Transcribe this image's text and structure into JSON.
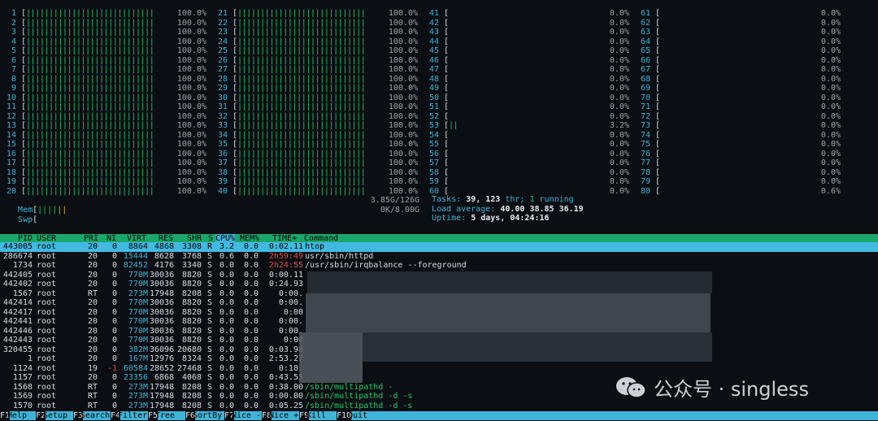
{
  "window": {
    "title": "htop"
  },
  "cpus": {
    "col1": [
      {
        "id": "1",
        "pct": "100.0%"
      },
      {
        "id": "2",
        "pct": "100.0%"
      },
      {
        "id": "3",
        "pct": "100.0%"
      },
      {
        "id": "4",
        "pct": "100.0%"
      },
      {
        "id": "5",
        "pct": "100.0%"
      },
      {
        "id": "6",
        "pct": "100.0%"
      },
      {
        "id": "7",
        "pct": "100.0%"
      },
      {
        "id": "8",
        "pct": "100.0%"
      },
      {
        "id": "9",
        "pct": "100.0%"
      },
      {
        "id": "10",
        "pct": "100.0%"
      },
      {
        "id": "11",
        "pct": "100.0%"
      },
      {
        "id": "12",
        "pct": "100.0%"
      },
      {
        "id": "13",
        "pct": "100.0%"
      },
      {
        "id": "14",
        "pct": "100.0%"
      },
      {
        "id": "15",
        "pct": "100.0%"
      },
      {
        "id": "16",
        "pct": "100.0%"
      },
      {
        "id": "17",
        "pct": "100.0%"
      },
      {
        "id": "18",
        "pct": "100.0%"
      },
      {
        "id": "19",
        "pct": "100.0%"
      },
      {
        "id": "20",
        "pct": "100.0%"
      }
    ],
    "col2": [
      {
        "id": "21",
        "pct": "100.0%"
      },
      {
        "id": "22",
        "pct": "100.0%"
      },
      {
        "id": "23",
        "pct": "100.0%"
      },
      {
        "id": "24",
        "pct": "100.0%"
      },
      {
        "id": "25",
        "pct": "100.0%"
      },
      {
        "id": "26",
        "pct": "100.0%"
      },
      {
        "id": "27",
        "pct": "100.0%"
      },
      {
        "id": "28",
        "pct": "100.0%"
      },
      {
        "id": "29",
        "pct": "100.0%"
      },
      {
        "id": "30",
        "pct": "100.0%"
      },
      {
        "id": "31",
        "pct": "100.0%"
      },
      {
        "id": "32",
        "pct": "100.0%"
      },
      {
        "id": "33",
        "pct": "100.0%"
      },
      {
        "id": "34",
        "pct": "100.0%"
      },
      {
        "id": "35",
        "pct": "100.0%"
      },
      {
        "id": "36",
        "pct": "100.0%"
      },
      {
        "id": "37",
        "pct": "100.0%"
      },
      {
        "id": "38",
        "pct": "100.0%"
      },
      {
        "id": "39",
        "pct": "100.0%"
      },
      {
        "id": "40",
        "pct": "100.0%"
      }
    ],
    "col3": [
      {
        "id": "41",
        "pct": "0.0%"
      },
      {
        "id": "42",
        "pct": "0.0%"
      },
      {
        "id": "43",
        "pct": "0.0%"
      },
      {
        "id": "44",
        "pct": "0.0%"
      },
      {
        "id": "45",
        "pct": "0.0%"
      },
      {
        "id": "46",
        "pct": "0.0%"
      },
      {
        "id": "47",
        "pct": "0.0%"
      },
      {
        "id": "48",
        "pct": "0.0%"
      },
      {
        "id": "49",
        "pct": "0.0%"
      },
      {
        "id": "50",
        "pct": "0.0%"
      },
      {
        "id": "51",
        "pct": "0.0%"
      },
      {
        "id": "52",
        "pct": "0.0%"
      },
      {
        "id": "53",
        "pct": "3.2%"
      },
      {
        "id": "54",
        "pct": "0.0%"
      },
      {
        "id": "55",
        "pct": "0.0%"
      },
      {
        "id": "56",
        "pct": "0.0%"
      },
      {
        "id": "57",
        "pct": "0.0%"
      },
      {
        "id": "58",
        "pct": "0.0%"
      },
      {
        "id": "59",
        "pct": "0.0%"
      },
      {
        "id": "60",
        "pct": "0.0%"
      }
    ],
    "col4": [
      {
        "id": "61",
        "pct": "0.0%"
      },
      {
        "id": "62",
        "pct": "0.0%"
      },
      {
        "id": "63",
        "pct": "0.0%"
      },
      {
        "id": "64",
        "pct": "0.0%"
      },
      {
        "id": "65",
        "pct": "0.0%"
      },
      {
        "id": "66",
        "pct": "0.0%"
      },
      {
        "id": "67",
        "pct": "0.0%"
      },
      {
        "id": "68",
        "pct": "0.0%"
      },
      {
        "id": "69",
        "pct": "0.0%"
      },
      {
        "id": "70",
        "pct": "0.0%"
      },
      {
        "id": "71",
        "pct": "0.0%"
      },
      {
        "id": "72",
        "pct": "0.0%"
      },
      {
        "id": "73",
        "pct": "0.0%"
      },
      {
        "id": "74",
        "pct": "0.0%"
      },
      {
        "id": "75",
        "pct": "0.0%"
      },
      {
        "id": "76",
        "pct": "0.0%"
      },
      {
        "id": "77",
        "pct": "0.0%"
      },
      {
        "id": "78",
        "pct": "0.0%"
      },
      {
        "id": "79",
        "pct": "0.0%"
      },
      {
        "id": "80",
        "pct": "0.6%"
      }
    ]
  },
  "meters": {
    "mem": {
      "label": "Mem",
      "value": "3.85G/126G"
    },
    "swp": {
      "label": "Swp",
      "value": "0K/8.00G"
    }
  },
  "summary": {
    "tasks_label": "Tasks:",
    "tasks": "39,",
    "thr": "123",
    "thr_label": "thr;",
    "running": "1",
    "running_label": "running",
    "load_label": "Load average:",
    "load1": "40.00",
    "load5": "38.85",
    "load15": "36.19",
    "uptime_label": "Uptime:",
    "uptime": "5 days, 04:24:16"
  },
  "columns": [
    "PID",
    "USER",
    "PRI",
    "NI",
    "VIRT",
    "RES",
    "SHR",
    "S",
    "CPU%",
    "MEM%",
    "TIME+",
    "Command"
  ],
  "processes": [
    {
      "pid": "443005",
      "user": "root",
      "pri": "20",
      "ni": "0",
      "virt": "8864",
      "res": "4868",
      "shr": "3308",
      "s": "R",
      "cpu": "3.2",
      "mem": "0.0",
      "time": "0:02.11",
      "cmd": "htop"
    },
    {
      "pid": "286674",
      "user": "root",
      "pri": "20",
      "ni": "0",
      "virt": "15444",
      "res": "8628",
      "shr": "3768",
      "s": "S",
      "cpu": "0.6",
      "mem": "0.0",
      "time": "2h59:49",
      "cmd": "usr/sbin/httpd"
    },
    {
      "pid": "1734",
      "user": "root",
      "pri": "20",
      "ni": "0",
      "virt": "82452",
      "res": "4176",
      "shr": "3340",
      "s": "S",
      "cpu": "0.0",
      "mem": "0.0",
      "time": "2h24:55",
      "cmd": "/usr/sbin/irqbalance --foreground"
    },
    {
      "pid": "442405",
      "user": "root",
      "pri": "20",
      "ni": "0",
      "virt": "770M",
      "res": "30036",
      "shr": "8820",
      "s": "S",
      "cpu": "0.0",
      "mem": "0.0",
      "time": "0:00.11",
      "cmd": ""
    },
    {
      "pid": "442402",
      "user": "root",
      "pri": "20",
      "ni": "0",
      "virt": "770M",
      "res": "30036",
      "shr": "8820",
      "s": "S",
      "cpu": "0.0",
      "mem": "0.0",
      "time": "0:24.93",
      "cmd": ""
    },
    {
      "pid": "1567",
      "user": "root",
      "pri": "RT",
      "ni": "0",
      "virt": "273M",
      "res": "17948",
      "shr": "8208",
      "s": "S",
      "cpu": "0.0",
      "mem": "0.0",
      "time": "0:00.",
      "cmd": ""
    },
    {
      "pid": "442414",
      "user": "root",
      "pri": "20",
      "ni": "0",
      "virt": "770M",
      "res": "30036",
      "shr": "8820",
      "s": "S",
      "cpu": "0.0",
      "mem": "0.0",
      "time": "0:00.",
      "cmd": ""
    },
    {
      "pid": "442417",
      "user": "root",
      "pri": "20",
      "ni": "0",
      "virt": "770M",
      "res": "30036",
      "shr": "8820",
      "s": "S",
      "cpu": "0.0",
      "mem": "0.0",
      "time": "0:00",
      "cmd": ""
    },
    {
      "pid": "442441",
      "user": "root",
      "pri": "20",
      "ni": "0",
      "virt": "770M",
      "res": "30036",
      "shr": "8820",
      "s": "S",
      "cpu": "0.0",
      "mem": "0.0",
      "time": "0:00.",
      "cmd": ""
    },
    {
      "pid": "442446",
      "user": "root",
      "pri": "20",
      "ni": "0",
      "virt": "770M",
      "res": "30036",
      "shr": "8820",
      "s": "S",
      "cpu": "0.0",
      "mem": "0.0",
      "time": "0:00.",
      "cmd": ""
    },
    {
      "pid": "442443",
      "user": "root",
      "pri": "20",
      "ni": "0",
      "virt": "770M",
      "res": "30036",
      "shr": "8820",
      "s": "S",
      "cpu": "0.0",
      "mem": "0.0",
      "time": "0:00",
      "cmd": ""
    },
    {
      "pid": "320455",
      "user": "root",
      "pri": "20",
      "ni": "0",
      "virt": "382M",
      "res": "36096",
      "shr": "20680",
      "s": "S",
      "cpu": "0.0",
      "mem": "0.0",
      "time": "0:03.98",
      "cmd": ""
    },
    {
      "pid": "1",
      "user": "root",
      "pri": "20",
      "ni": "0",
      "virt": "167M",
      "res": "12976",
      "shr": "8324",
      "s": "S",
      "cpu": "0.0",
      "mem": "0.0",
      "time": "2:53.27",
      "cmd": ""
    },
    {
      "pid": "1124",
      "user": "root",
      "pri": "19",
      "ni": "-1",
      "virt": "60584",
      "res": "28652",
      "shr": "27468",
      "s": "S",
      "cpu": "0.0",
      "mem": "0.0",
      "time": "0:18.",
      "cmd": ""
    },
    {
      "pid": "1157",
      "user": "root",
      "pri": "20",
      "ni": "0",
      "virt": "23356",
      "res": "6868",
      "shr": "4068",
      "s": "S",
      "cpu": "0.0",
      "mem": "0.0",
      "time": "0:43.55",
      "cmd": ""
    },
    {
      "pid": "1568",
      "user": "root",
      "pri": "RT",
      "ni": "0",
      "virt": "273M",
      "res": "17948",
      "shr": "8208",
      "s": "S",
      "cpu": "0.0",
      "mem": "0.0",
      "time": "0:38.00",
      "cmd": "/sbin/multipathd -"
    },
    {
      "pid": "1569",
      "user": "root",
      "pri": "RT",
      "ni": "0",
      "virt": "273M",
      "res": "17948",
      "shr": "8208",
      "s": "S",
      "cpu": "0.0",
      "mem": "0.0",
      "time": "0:00.00",
      "cmd": "/sbin/multipathd -d -s"
    },
    {
      "pid": "1570",
      "user": "root",
      "pri": "RT",
      "ni": "0",
      "virt": "273M",
      "res": "17948",
      "shr": "8208",
      "s": "S",
      "cpu": "0.0",
      "mem": "0.0",
      "time": "0:05.25",
      "cmd": "/sbin/multipathd -d -s"
    }
  ],
  "fkeys": [
    {
      "key": "F1",
      "label": "Help"
    },
    {
      "key": "F2",
      "label": "Setup"
    },
    {
      "key": "F3",
      "label": "Search"
    },
    {
      "key": "F4",
      "label": "Filter"
    },
    {
      "key": "F5",
      "label": "Tree"
    },
    {
      "key": "F6",
      "label": "SortBy"
    },
    {
      "key": "F7",
      "label": "Nice -"
    },
    {
      "key": "F8",
      "label": "Nice +"
    },
    {
      "key": "F9",
      "label": "Kill"
    },
    {
      "key": "F10",
      "label": "Quit"
    }
  ],
  "watermark": {
    "text": "公众号 · singless"
  }
}
